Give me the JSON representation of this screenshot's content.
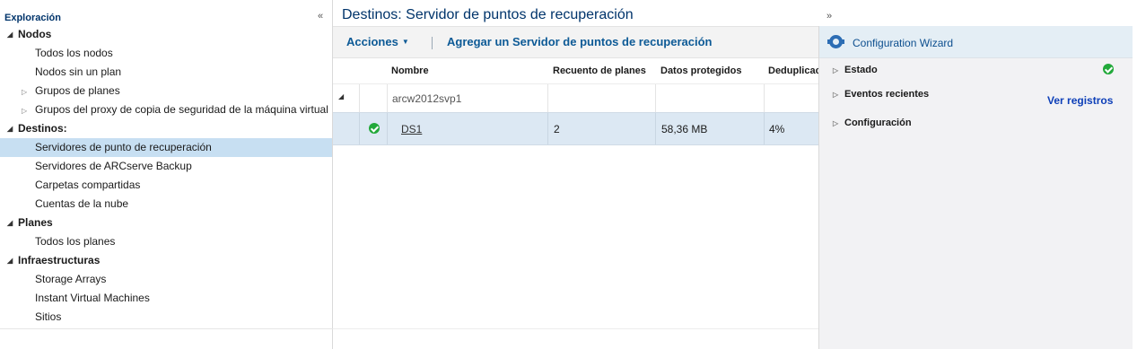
{
  "left_panel": {
    "title": "Exploración",
    "collapse_glyph": "«",
    "groups": [
      {
        "label": "Nodos",
        "items": [
          "Todos los nodos",
          "Nodos sin un plan"
        ],
        "expandable_items": [
          "Grupos de planes",
          "Grupos del proxy de copia de seguridad de la máquina virtual"
        ]
      },
      {
        "label": "Destinos:",
        "items": [
          "Servidores de punto de recuperación",
          "Servidores de ARCserve Backup",
          "Carpetas compartidas",
          "Cuentas de la nube"
        ],
        "selected": "Servidores de punto de recuperación"
      },
      {
        "label": "Planes",
        "items": [
          "Todos los planes"
        ]
      },
      {
        "label": "Infraestructuras",
        "items": [
          "Storage Arrays",
          "Instant Virtual Machines",
          "Sitios"
        ]
      }
    ]
  },
  "center": {
    "title": "Destinos: Servidor de puntos de recuperación",
    "toolbar": {
      "actions_label": "Acciones",
      "add_label": "Agregar un Servidor de puntos de recuperación"
    },
    "grid": {
      "columns": [
        "Nombre",
        "Recuento de planes",
        "Datos protegidos",
        "Deduplicac"
      ],
      "group_row": {
        "name": "arcw2012svp1"
      },
      "rows": [
        {
          "status": "ok",
          "name": "DS1",
          "plan_count": "2",
          "protected": "58,36 MB",
          "dedup": "4%"
        }
      ]
    }
  },
  "right_panel": {
    "expand_glyph": "»",
    "wizard_label": "Configuration Wizard",
    "sections": [
      {
        "label": "Estado",
        "status": "ok"
      },
      {
        "label": "Eventos recientes",
        "link": "Ver registros"
      },
      {
        "label": "Configuración"
      }
    ]
  },
  "colors": {
    "accent": "#0d5a96",
    "selected_row": "#c7dff2",
    "ok_green": "#22a93a"
  },
  "icons": [
    "collapse-left-icon",
    "expand-right-icon",
    "gear-icon",
    "check-circle-icon",
    "triangle-down-icon",
    "triangle-right-icon",
    "caret-down-icon"
  ]
}
